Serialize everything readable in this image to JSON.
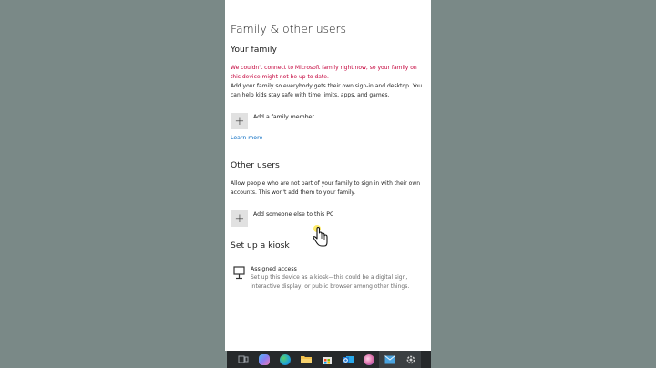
{
  "page": {
    "title": "Family & other users"
  },
  "your_family": {
    "heading": "Your family",
    "error_text": "We couldn't connect to Microsoft family right now, so your family on this device might not be up to date.",
    "description": "Add your family so everybody gets their own sign-in and desktop. You can help kids stay safe with time limits, apps, and games.",
    "add_label": "Add a family member",
    "learn_more": "Learn more"
  },
  "other_users": {
    "heading": "Other users",
    "description": "Allow people who are not part of your family to sign in with their own accounts. This won't add them to your family.",
    "add_label": "Add someone else to this PC"
  },
  "kiosk": {
    "heading": "Set up a kiosk",
    "title": "Assigned access",
    "description": "Set up this device as a kiosk—this could be a digital sign, interactive display, or public browser among other things."
  },
  "taskbar": {
    "items": [
      {
        "icon": "task-view-icon",
        "color": "#9aa0a6"
      },
      {
        "icon": "copilot-icon",
        "color": "#8a7cf0"
      },
      {
        "icon": "edge-icon",
        "color": "#1fa3d6"
      },
      {
        "icon": "file-explorer-icon",
        "color": "#f2c14e"
      },
      {
        "icon": "store-icon",
        "color": "#e6e6e6"
      },
      {
        "icon": "outlook-icon",
        "color": "#1f78d1"
      },
      {
        "icon": "paint-icon",
        "color": "#d86aa5"
      },
      {
        "icon": "mail-icon",
        "color": "#4aa3df"
      },
      {
        "icon": "settings-icon",
        "color": "#c9c9c9"
      }
    ]
  },
  "colors": {
    "error": "#c4003a",
    "link": "#0067c0",
    "background": "#7b8a88"
  }
}
